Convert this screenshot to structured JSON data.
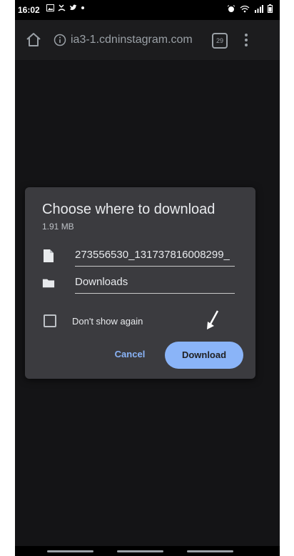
{
  "status_bar": {
    "time": "16:02",
    "notification_icons": [
      "gallery-icon",
      "missed-call-icon",
      "twitter-icon",
      "dot-icon"
    ],
    "system_icons": [
      "alarm-icon",
      "wifi-icon",
      "signal-icon",
      "battery-icon"
    ]
  },
  "toolbar": {
    "url": "ia3-1.cdninstagram.com",
    "tab_count": "29"
  },
  "dialog": {
    "title": "Choose where to download",
    "size": "1.91 MB",
    "filename": "273556530_131737816008299_",
    "location": "Downloads",
    "checkbox_label": "Don't show again",
    "cancel_label": "Cancel",
    "download_label": "Download"
  },
  "colors": {
    "accent": "#8ab4f8",
    "dialog_bg": "#3b3b3f",
    "page_bg": "#141416"
  }
}
